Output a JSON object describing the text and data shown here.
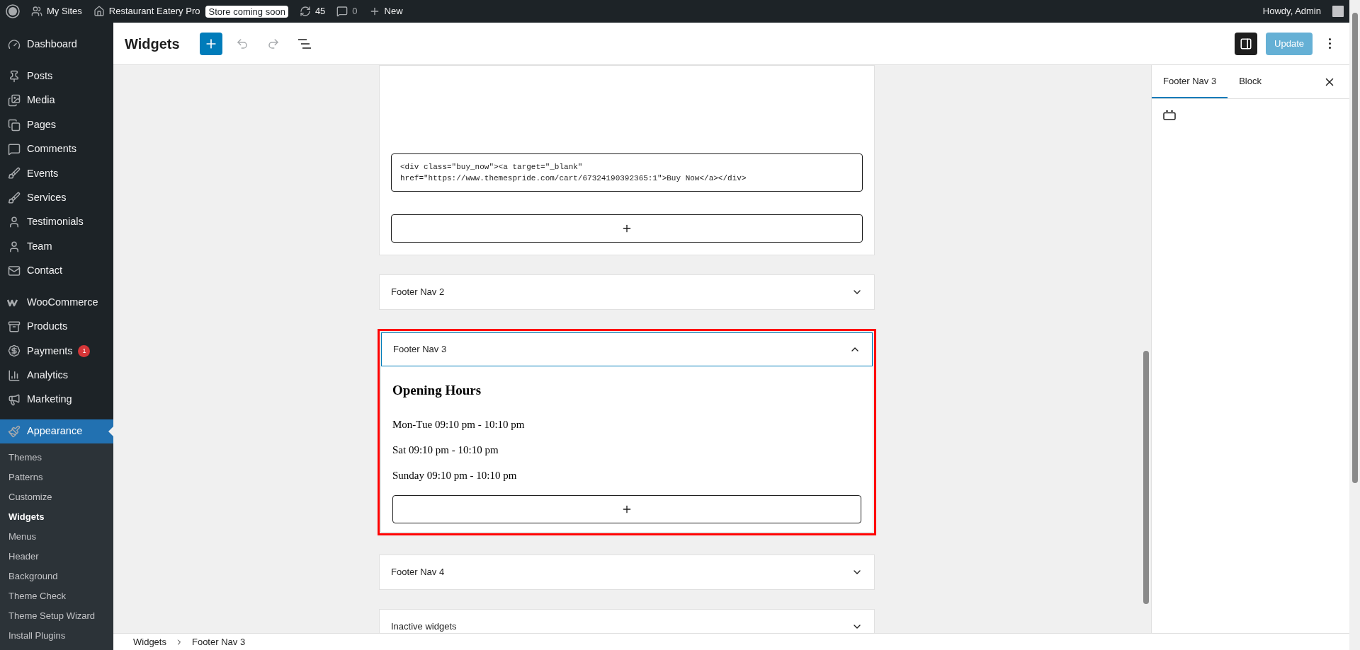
{
  "admin_bar": {
    "my_sites": "My Sites",
    "site_name": "Restaurant Eatery Pro",
    "store_badge": "Store coming soon",
    "updates_count": "45",
    "comments_count": "0",
    "new_label": "New",
    "greeting": "Howdy, Admin"
  },
  "sidebar": {
    "groups": [
      {
        "items": [
          {
            "label": "Dashboard",
            "kind": "dashboard",
            "selected": false
          }
        ]
      },
      {
        "items": [
          {
            "label": "Posts",
            "kind": "pin",
            "selected": false
          },
          {
            "label": "Media",
            "kind": "media",
            "selected": false
          },
          {
            "label": "Pages",
            "kind": "pages",
            "selected": false
          },
          {
            "label": "Comments",
            "kind": "comment",
            "selected": false
          },
          {
            "label": "Events",
            "kind": "brush",
            "selected": false
          },
          {
            "label": "Services",
            "kind": "brush",
            "selected": false
          },
          {
            "label": "Testimonials",
            "kind": "user",
            "selected": false
          },
          {
            "label": "Team",
            "kind": "user",
            "selected": false
          },
          {
            "label": "Contact",
            "kind": "mail",
            "selected": false
          }
        ]
      },
      {
        "items": [
          {
            "label": "WooCommerce",
            "kind": "woo",
            "selected": false
          },
          {
            "label": "Products",
            "kind": "archive",
            "selected": false
          },
          {
            "label": "Payments",
            "kind": "dollar",
            "selected": false,
            "badge": "1"
          },
          {
            "label": "Analytics",
            "kind": "chart",
            "selected": false
          },
          {
            "label": "Marketing",
            "kind": "megaphone",
            "selected": false
          }
        ]
      },
      {
        "items": [
          {
            "label": "Appearance",
            "kind": "appearance",
            "selected": true
          }
        ]
      }
    ],
    "submenu": [
      {
        "label": "Themes",
        "selected": false
      },
      {
        "label": "Patterns",
        "selected": false
      },
      {
        "label": "Customize",
        "selected": false
      },
      {
        "label": "Widgets",
        "selected": true
      },
      {
        "label": "Menus",
        "selected": false
      },
      {
        "label": "Header",
        "selected": false
      },
      {
        "label": "Background",
        "selected": false
      },
      {
        "label": "Theme Check",
        "selected": false
      },
      {
        "label": "Theme Setup Wizard",
        "selected": false
      },
      {
        "label": "Install Plugins",
        "selected": false
      }
    ]
  },
  "header": {
    "title": "Widgets",
    "settings_panel_open": true,
    "update_button": {
      "label": "Update",
      "disabled": true
    }
  },
  "widget_areas": [
    {
      "expanded": true,
      "highlighted": false,
      "blocks": [
        {
          "kind": "html",
          "lines": [
            "<div class=\"buy_now\"><a target=\"_blank\"",
            "href=\"https://www.themespride.com/cart/67324190392365:1\">Buy Now</a></div>"
          ]
        }
      ]
    },
    {
      "title": "Footer Nav 2",
      "expanded": false,
      "highlighted": false
    },
    {
      "title": "Footer Nav 3",
      "expanded": true,
      "highlighted": true,
      "blocks": [
        {
          "kind": "heading",
          "text": "Opening Hours"
        },
        {
          "kind": "paragraph",
          "text": "Mon-Tue 09:10 pm - 10:10 pm"
        },
        {
          "kind": "paragraph",
          "text": "Sat 09:10 pm - 10:10 pm"
        },
        {
          "kind": "paragraph",
          "text": "Sunday 09:10 pm - 10:10 pm"
        }
      ]
    },
    {
      "title": "Footer Nav 4",
      "expanded": false,
      "highlighted": false
    },
    {
      "title": "Inactive widgets",
      "expanded": false,
      "highlighted": false
    }
  ],
  "settings_panel": {
    "tabs": [
      {
        "label": "Footer Nav 3",
        "selected": true
      },
      {
        "label": "Block",
        "selected": false
      }
    ]
  },
  "breadcrumb": [
    "Widgets",
    "Footer Nav 3"
  ]
}
